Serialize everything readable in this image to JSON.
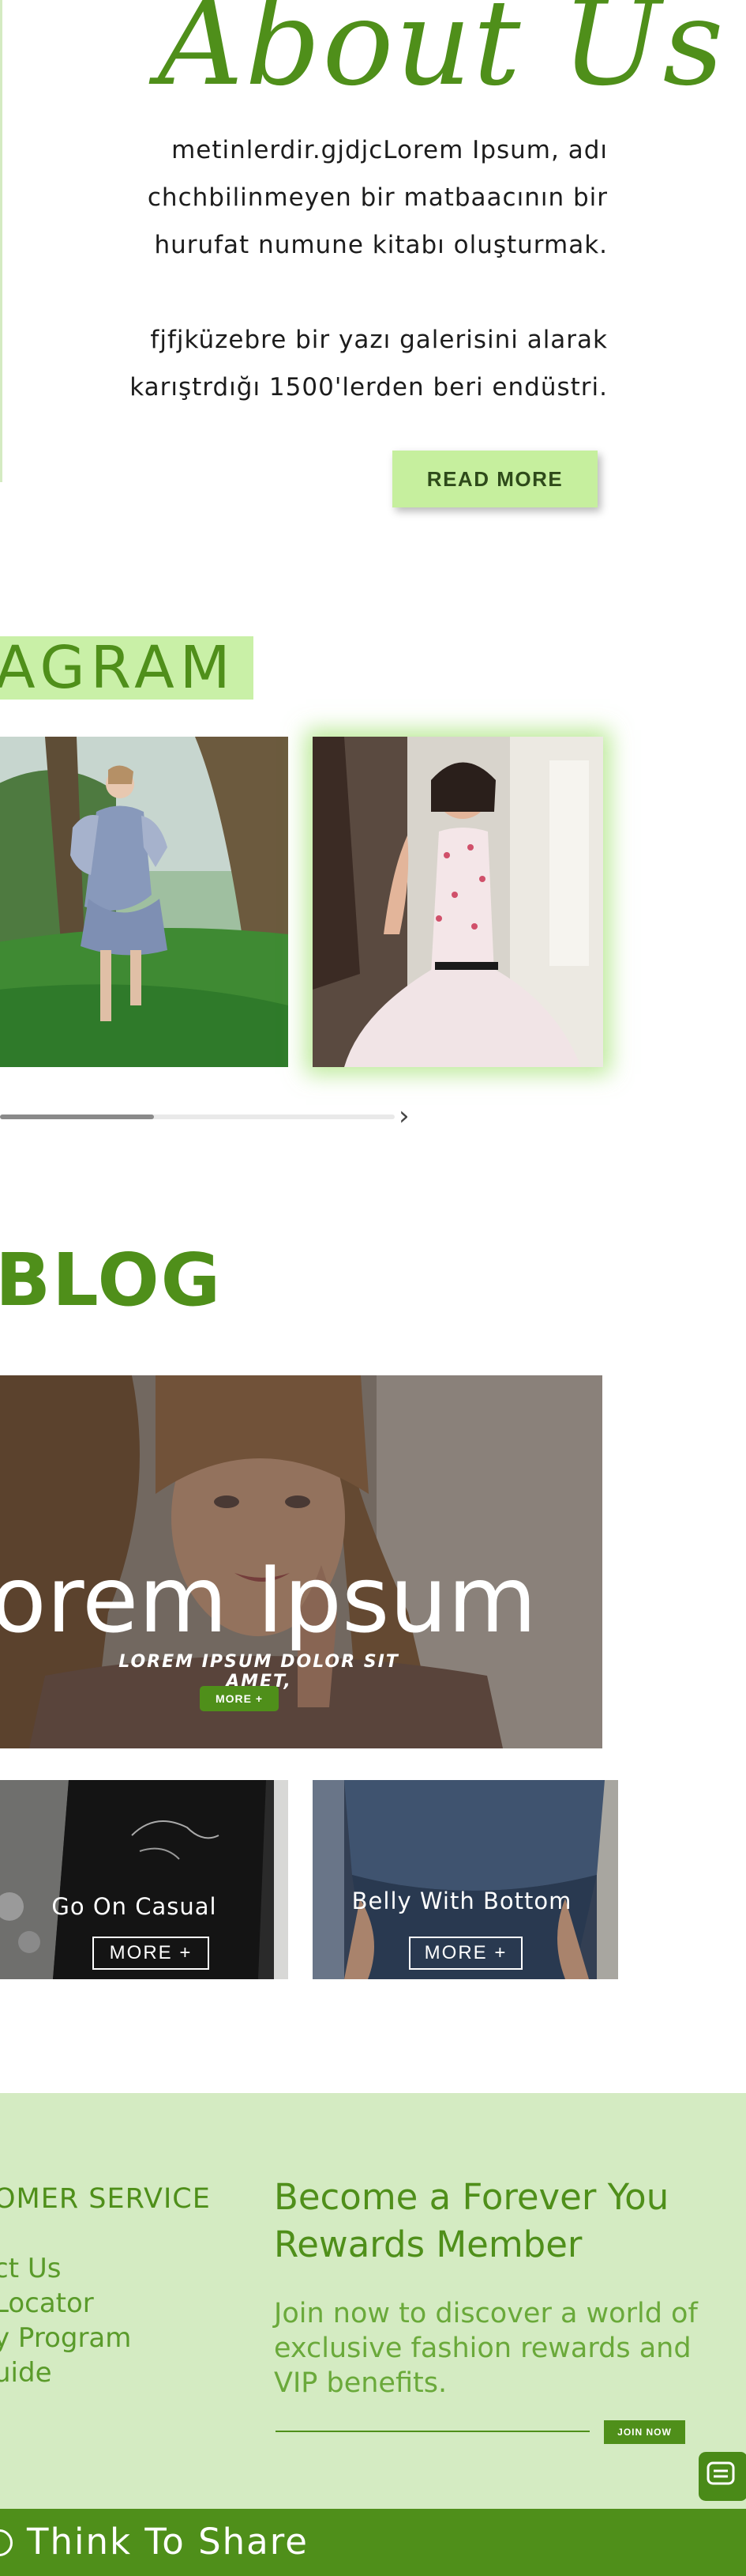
{
  "about": {
    "title": "About Us",
    "lines": [
      "metinlerdir.gjdjcLorem Ipsum, adı",
      "chchbilinmeyen bir matbaacının bir",
      "hurufat numune kitabı oluşturmak.",
      "fjfjküzebre bir yazı galerisini alarak",
      "karıştrdığı 1500'lerden beri endüstri."
    ],
    "read_more_label": "READ MORE"
  },
  "instagram": {
    "title": "AGRAM",
    "progress": 0.39
  },
  "blog": {
    "title": "BLOG",
    "hero": {
      "title": "orem Ipsum",
      "subtitle": "LOREM IPSUM DOLOR SIT AMET,",
      "more_label": "MORE +"
    },
    "cards": [
      {
        "title": "Go On Casual",
        "button": "MORE +"
      },
      {
        "title": "Belly With Bottom",
        "button": "MORE +"
      }
    ]
  },
  "footer": {
    "service_title": "OMER SERVICE",
    "service_links": [
      "ct Us",
      "Locator",
      "y Program",
      "uide"
    ],
    "rewards_title": "Become a Forever You Rewards Member",
    "rewards_text": "Join now to discover a world of exclusive fashion rewards and VIP benefits.",
    "join_label": "JOIN NOW"
  },
  "bottom_bar": {
    "label": "Think To Share"
  },
  "colors": {
    "brand_green": "#4f8f1a",
    "light_green": "#c6ef9e",
    "footer_bg": "#d4ebc2"
  },
  "icons": [
    "chevron-right-icon",
    "chat-icon",
    "share-icon"
  ]
}
